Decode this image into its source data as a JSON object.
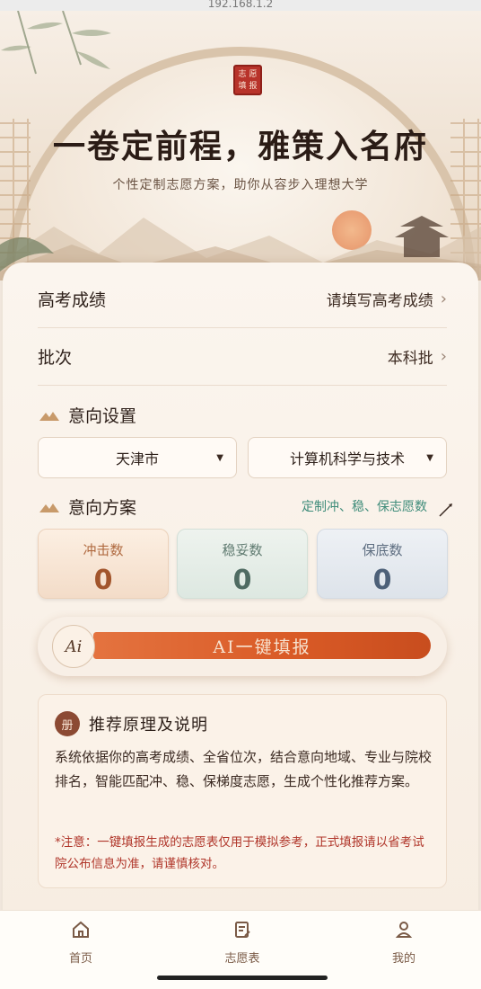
{
  "browser": {
    "url": "192.168.1.2"
  },
  "hero": {
    "seal_chars": [
      "志",
      "愿",
      "填",
      "报"
    ],
    "title": "一卷定前程，雅策入名府",
    "subtitle": "个性定制志愿方案，助你从容步入理想大学"
  },
  "form": {
    "score": {
      "label": "高考成绩",
      "value": "请填写高考成绩"
    },
    "batch": {
      "label": "批次",
      "value": "本科批"
    }
  },
  "intent_settings": {
    "title": "意向设置",
    "region": "天津市",
    "major": "计算机科学与技术"
  },
  "intent_plan": {
    "title": "意向方案",
    "hint": "定制冲、稳、保志愿数",
    "stats": [
      {
        "label": "冲击数",
        "value": "0"
      },
      {
        "label": "稳妥数",
        "value": "0"
      },
      {
        "label": "保底数",
        "value": "0"
      }
    ]
  },
  "ai_button": {
    "badge": "Ai",
    "label": "AI一键填报"
  },
  "info": {
    "icon": "册",
    "title": "推荐原理及说明",
    "body": "系统依据你的高考成绩、全省位次，结合意向地域、专业与院校排名，智能匹配冲、稳、保梯度志愿，生成个性化推荐方案。",
    "note": "*注意：一键填报生成的志愿表仅用于模拟参考，正式填报请以省考试院公布信息为准，请谨慎核对。"
  },
  "nav": {
    "items": [
      {
        "label": "首页",
        "icon": "home-icon"
      },
      {
        "label": "志愿表",
        "icon": "document-edit-icon"
      },
      {
        "label": "我的",
        "icon": "user-icon"
      }
    ]
  },
  "colors": {
    "accent_orange": "#d95a26",
    "hint_green": "#3f8c7a",
    "note_red": "#b0362a",
    "brown": "#8c4a33"
  }
}
